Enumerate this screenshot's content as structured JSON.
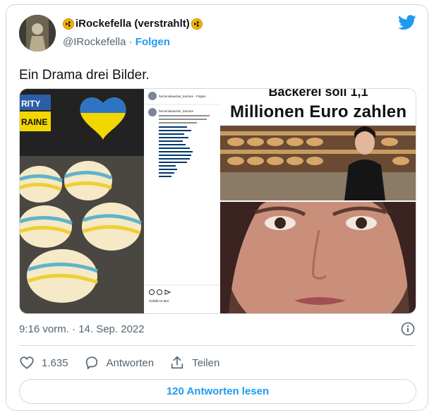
{
  "author": {
    "display_name": "iRockefella (verstrahlt)",
    "handle": "@IRockefella",
    "separator": " · ",
    "follow_label": "Folgen"
  },
  "tweet": {
    "text": "Ein Drama drei Bilder."
  },
  "media": {
    "image1_label_top": "RITY",
    "image1_label_bottom": "RAINE",
    "image2_account": "herzenskaecker_kamme · Folgen",
    "image2_caption_user": "herzenskaecker_kamme",
    "image2_liked": "Gefällt 16 Mal",
    "image3_headline_top": "Bäckerei soll 1,1",
    "image3_headline": "Millionen Euro zahlen"
  },
  "meta": {
    "timestamp": "9:16 vorm. · 14. Sep. 2022"
  },
  "actions": {
    "likes": "1.635",
    "reply_label": "Antworten",
    "share_label": "Teilen"
  },
  "read_replies_label": "120 Antworten lesen",
  "colors": {
    "accent": "#1d9bf0",
    "text": "#0f1419",
    "muted": "#536471",
    "border": "#cfd9de"
  }
}
